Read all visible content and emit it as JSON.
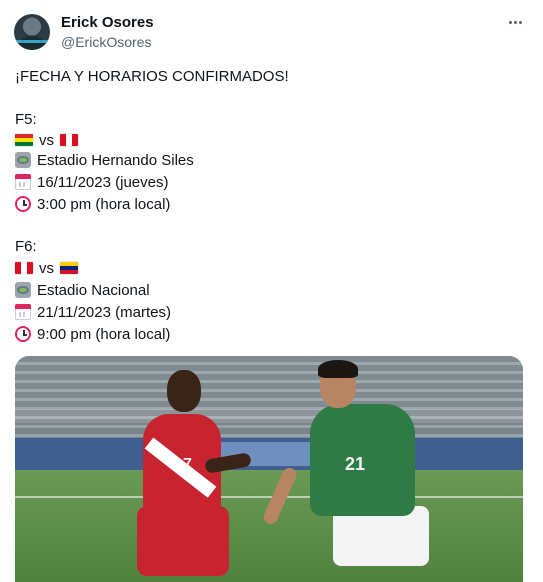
{
  "author": {
    "name": "Erick Osores",
    "handle": "@ErickOsores",
    "avatar_icon": "profile-photo"
  },
  "tweet": {
    "headline": "¡FECHA Y HORARIOS CONFIRMADOS!",
    "matches": [
      {
        "round": "F5:",
        "home_flag": "bolivia-flag-icon",
        "away_flag": "peru-flag-icon",
        "vs": "vs",
        "stadium": "Estadio Hernando Siles",
        "date": "16/11/2023 (jueves)",
        "time": "3:00 pm (hora local)"
      },
      {
        "round": "F6:",
        "home_flag": "peru-flag-icon",
        "away_flag": "venezuela-flag-icon",
        "vs": "vs",
        "stadium": "Estadio Nacional",
        "date": "21/11/2023 (martes)",
        "time": "9:00 pm (hora local)"
      }
    ]
  },
  "photo": {
    "player_left_number": "7",
    "player_right_number": "21"
  },
  "colors": {
    "text": "#0f1419",
    "secondary": "#536471",
    "peru_red": "#d91023",
    "bolivia_red": "#d52b1e",
    "bolivia_yellow": "#f9e300",
    "bolivia_green": "#007934",
    "venezuela_yellow": "#ffcc00",
    "venezuela_blue": "#00247d",
    "venezuela_red": "#cf142b"
  }
}
